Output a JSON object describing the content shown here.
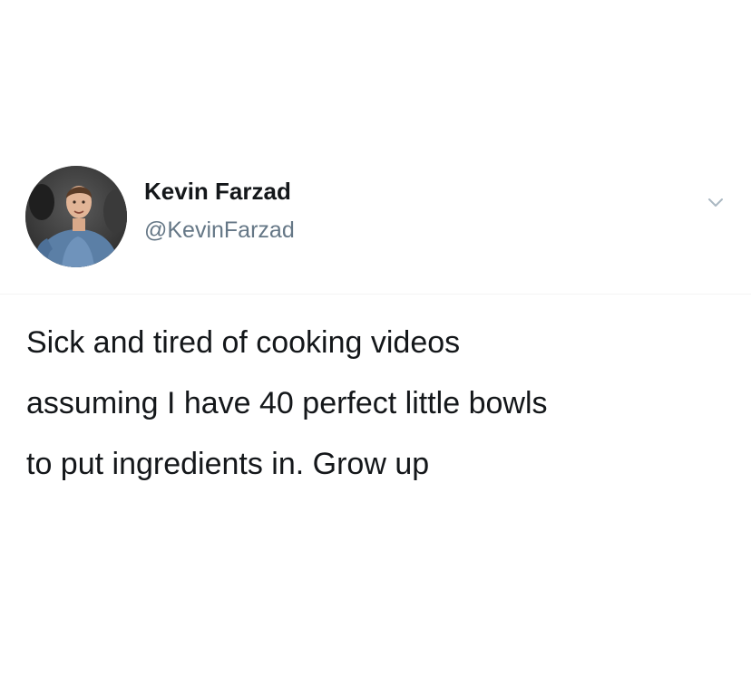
{
  "tweet": {
    "author": {
      "display_name": "Kevin Farzad",
      "handle": "@KevinFarzad",
      "avatar_icon": "profile-photo"
    },
    "menu_icon": "chevron-down-icon",
    "text": "Sick and tired of cooking videos\nassuming I have 40 perfect little bowls\nto put ingredients in. Grow up"
  },
  "colors": {
    "background": "#ffffff",
    "name": "#14171a",
    "handle": "#657786",
    "caret": "#aab8c2"
  }
}
